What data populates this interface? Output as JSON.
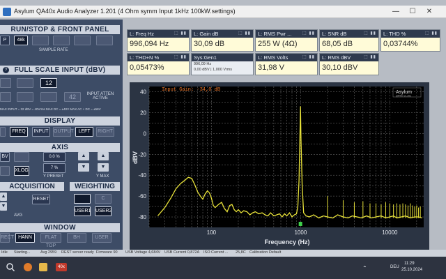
{
  "window": {
    "title": "Asylum QA40x Audio Analyzer 1.201 (4 Ohm symm Input 1kHz 100kW.settings)",
    "min": "—",
    "max": "☐",
    "close": "✕"
  },
  "left": {
    "run": {
      "title": "RUN/STOP & FRONT PANEL",
      "b1": "P",
      "b2": "48k",
      "b3": "",
      "b4": "",
      "b5": "",
      "b6": "",
      "sample_rate": "SAMPLE RATE"
    },
    "fsi": {
      "title": "FULL SCALE INPUT (dBV)",
      "v12": "12",
      "v42": "42",
      "attn": "INPUT ATTEN ACTIVE",
      "line": "MAX INPUT = 32 dBV = 40Vrms   MAX DC = ±40V   MAX AC + DC = ±56V"
    },
    "display": {
      "title": "DISPLAY",
      "freq": "FREQ",
      "input": "INPUT",
      "output": "OUTPUT",
      "left": "LEFT",
      "right": "RIGHT"
    },
    "axis": {
      "title": "AXIS",
      "xlog": "XLOG",
      "preset1": "0.0 %",
      "preset2": "7 %",
      "ypreset": "Y PRESET",
      "ymax": "Y MAX",
      "bv": "BV"
    },
    "acq": {
      "title": "ACQUISITION",
      "reset": "RESET",
      "avg": "AVG"
    },
    "weight": {
      "title": "WEIGHTING",
      "c": "C",
      "user1": "USER1",
      "user2": "USER2"
    },
    "window": {
      "title": "WINDOW",
      "rect": "RECT",
      "hann": "HANN",
      "flattop": "FLAT TOP",
      "bh": "BH",
      "user": "USER"
    }
  },
  "meters": [
    {
      "label": "L: Freq Hz",
      "value": "996,094 Hz"
    },
    {
      "label": "L: Gain dB",
      "value": "30,09 dB"
    },
    {
      "label": "L: RMS Pwr ...",
      "value": "255 W (4Ω)"
    },
    {
      "label": "L: SNR dB",
      "value": "68,05 dB"
    },
    {
      "label": "L: THD %",
      "value": "0,03744%"
    },
    {
      "label": "L: THD+N %",
      "value": "0,05473%"
    },
    {
      "label": "Sys:Gen1",
      "value": "996,09 Hz",
      "value2": "0,00 dBV | 1,000 Vrms"
    },
    {
      "label": "L: RMS Volts",
      "value": "31,98 V"
    },
    {
      "label": "L: RMS dBV",
      "value": "30,10 dBV"
    }
  ],
  "meter_icons": "⬚ ▮▮",
  "chart_data": {
    "type": "line",
    "annotation": "Input Gain: -34,0 dB",
    "ylabel": "dBV",
    "xlabel": "Frequency (Hz)",
    "logo": "Asylum",
    "logo_sub": "QA40x v1.201",
    "xscale": "log",
    "xlim": [
      20,
      24000
    ],
    "ylim": [
      -90,
      45
    ],
    "yticks": [
      40,
      20,
      0,
      -20,
      -40,
      -60,
      -80
    ],
    "xticks": [
      100,
      1000,
      10000
    ],
    "xtick_labels": [
      "100",
      "1000",
      "10000"
    ],
    "grid": true,
    "series_color": "#e8e23a",
    "fundamental": {
      "x": 996,
      "y": 26
    },
    "series": [
      {
        "x": [
          25,
          30,
          35,
          40,
          45,
          50,
          55,
          60,
          65,
          70,
          75,
          80,
          85,
          90,
          95,
          100,
          105,
          110,
          120,
          130,
          140,
          150,
          160,
          170,
          180,
          190,
          200,
          215,
          230,
          250,
          270,
          290,
          310,
          340,
          370,
          400,
          430,
          460,
          500,
          540,
          580,
          620,
          660,
          700,
          750,
          800,
          850,
          900,
          930,
          960,
          980,
          996,
          1010,
          1040,
          1080,
          1150,
          1250,
          1400,
          1600,
          1800,
          2000,
          2300,
          2600,
          3000,
          3400,
          3800,
          4300,
          4800,
          5500,
          6200,
          7000,
          8000,
          9000,
          10000,
          11000,
          12000,
          13500,
          15000,
          17000,
          19000,
          21000,
          23000
        ],
        "y": [
          -79,
          -71,
          -62,
          -53,
          -48,
          -45,
          -42,
          -43,
          -49,
          -56,
          -60,
          -63,
          -58,
          -55,
          -57,
          -62,
          -69,
          -71,
          -68,
          -66,
          -72,
          -75,
          -69,
          -68,
          -73,
          -75,
          -73,
          -76,
          -74,
          -75,
          -78,
          -76,
          -75,
          -77,
          -76,
          -78,
          -79,
          -76,
          -79,
          -78,
          -77,
          -80,
          -77,
          -79,
          -76,
          -80,
          -78,
          -77,
          -70,
          -45,
          -5,
          26,
          -5,
          -50,
          -76,
          -79,
          -80,
          -78,
          -81,
          -79,
          -80,
          -81,
          -78,
          -80,
          -81,
          -79,
          -80,
          -81,
          -79,
          -81,
          -80,
          -79,
          -81,
          -80,
          -79,
          -81,
          -80,
          -79,
          -81,
          -80,
          -80,
          -81
        ]
      }
    ],
    "harmonic_spikes": [
      {
        "x": 2000,
        "y": -60
      },
      {
        "x": 3000,
        "y": -64
      },
      {
        "x": 4000,
        "y": -66
      },
      {
        "x": 5000,
        "y": -65
      },
      {
        "x": 6000,
        "y": -67
      },
      {
        "x": 7000,
        "y": -67
      },
      {
        "x": 8000,
        "y": -68
      },
      {
        "x": 9000,
        "y": -66
      },
      {
        "x": 10000,
        "y": -67
      },
      {
        "x": 11000,
        "y": -68
      },
      {
        "x": 12000,
        "y": -67
      },
      {
        "x": 13000,
        "y": -68
      },
      {
        "x": 14000,
        "y": -67
      },
      {
        "x": 15000,
        "y": -68
      },
      {
        "x": 16000,
        "y": -69
      },
      {
        "x": 17000,
        "y": -67
      },
      {
        "x": 18000,
        "y": -69
      },
      {
        "x": 19000,
        "y": -70
      },
      {
        "x": 20000,
        "y": -69
      },
      {
        "x": 21000,
        "y": -71
      },
      {
        "x": 22000,
        "y": -70
      }
    ]
  },
  "status": [
    "Idle",
    "Starting...",
    "Avg 2959",
    "REST server ready",
    "Firmware 90",
    "USB Voltage 4,684V",
    "USB Current 0,872A",
    "ISO Current ...",
    "25,8C",
    "Calibration Default"
  ],
  "taskbar": {
    "app": "40x",
    "time": "11:29",
    "date": "25.10.2024",
    "lang": "DEU"
  }
}
